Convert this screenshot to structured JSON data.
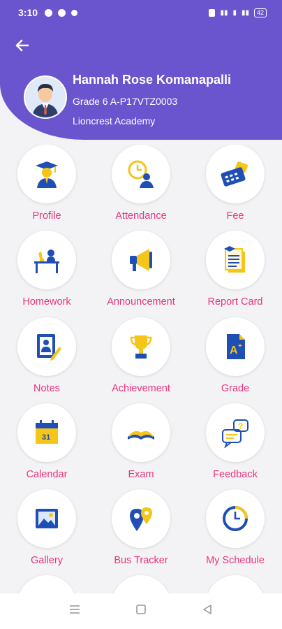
{
  "status_bar": {
    "time": "3:10",
    "battery": "42"
  },
  "header": {
    "student_name": "Hannah Rose Komanapalli",
    "grade": "Grade 6 A-P17VTZ0003",
    "school": "Lioncrest Academy"
  },
  "menu": {
    "items": [
      {
        "label": "Profile",
        "icon": "graduate-icon"
      },
      {
        "label": "Attendance",
        "icon": "clock-person-icon"
      },
      {
        "label": "Fee",
        "icon": "calculator-money-icon"
      },
      {
        "label": "Homework",
        "icon": "desk-study-icon"
      },
      {
        "label": "Announcement",
        "icon": "megaphone-icon"
      },
      {
        "label": "Report Card",
        "icon": "report-card-icon"
      },
      {
        "label": "Notes",
        "icon": "notebook-pen-icon"
      },
      {
        "label": "Achievement",
        "icon": "trophy-icon"
      },
      {
        "label": "Grade",
        "icon": "grade-a-plus-icon"
      },
      {
        "label": "Calendar",
        "icon": "calendar-icon"
      },
      {
        "label": "Exam",
        "icon": "open-book-icon"
      },
      {
        "label": "Feedback",
        "icon": "feedback-chat-icon"
      },
      {
        "label": "Gallery",
        "icon": "image-icon"
      },
      {
        "label": "Bus Tracker",
        "icon": "map-pin-icon"
      },
      {
        "label": "My Schedule",
        "icon": "schedule-clock-icon"
      }
    ]
  },
  "colors": {
    "primary": "#6a55cf",
    "label": "#e8357d",
    "icon_blue": "#1f4fb4",
    "icon_yellow": "#f5c518"
  }
}
